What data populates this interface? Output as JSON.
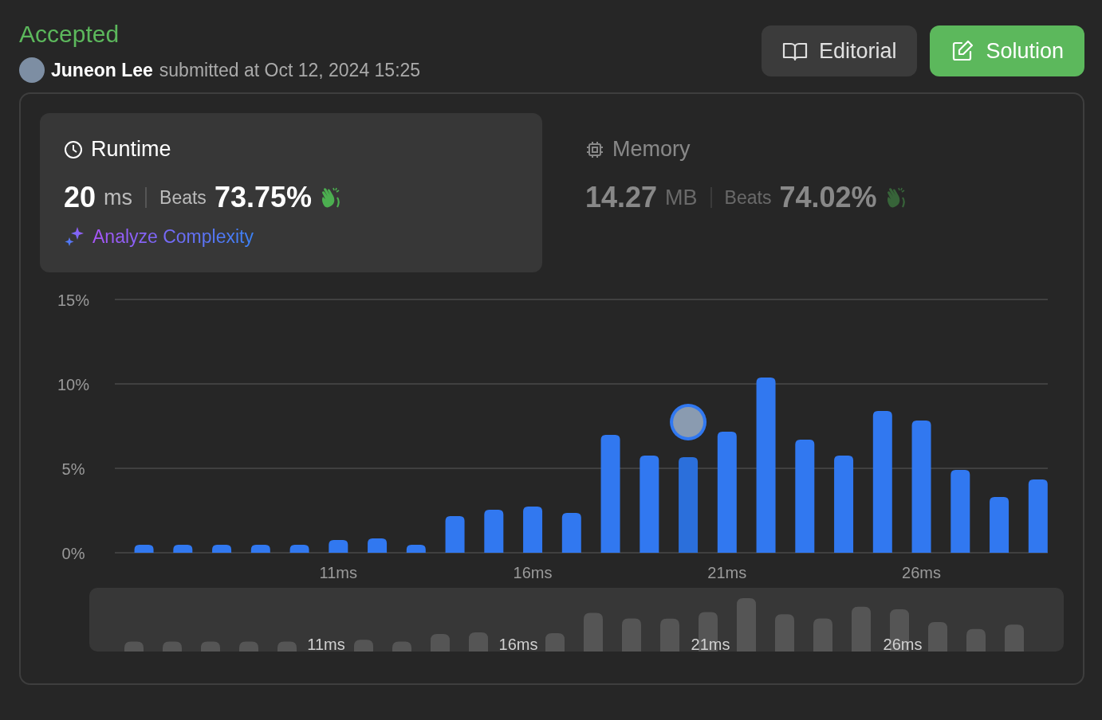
{
  "header": {
    "status": "Accepted",
    "user": "Juneon Lee",
    "submitted": "submitted at Oct 12, 2024 15:25"
  },
  "buttons": [
    {
      "label": "Editorial",
      "kind": "editorial"
    },
    {
      "label": "Solution",
      "kind": "solution"
    }
  ],
  "stats": [
    {
      "kind": "runtime",
      "title": "Runtime",
      "value": "20",
      "unit": "ms",
      "beats_label": "Beats",
      "percent": "73.75%",
      "selected": true,
      "link": "Analyze Complexity"
    },
    {
      "kind": "memory",
      "title": "Memory",
      "value": "14.27",
      "unit": "MB",
      "beats_label": "Beats",
      "percent": "74.02%",
      "selected": false
    }
  ],
  "chart": {
    "chart_data": {
      "type": "bar",
      "x": [
        6,
        7,
        8,
        9,
        10,
        11,
        12,
        13,
        14,
        15,
        16,
        17,
        18,
        19,
        20,
        21,
        22,
        23,
        24,
        25,
        26,
        27,
        28,
        29
      ],
      "values": [
        0.47,
        0.47,
        0.47,
        0.47,
        0.47,
        0.75,
        0.85,
        0.47,
        2.17,
        2.55,
        2.74,
        2.36,
        6.98,
        5.75,
        5.66,
        7.17,
        10.38,
        6.7,
        5.75,
        8.4,
        7.83,
        4.91,
        3.3,
        4.34
      ],
      "ylim": [
        0,
        15
      ],
      "yticks": [
        {
          "value": 0,
          "label": "0%"
        },
        {
          "value": 5,
          "label": "5%"
        },
        {
          "value": 10,
          "label": "10%"
        },
        {
          "value": 15,
          "label": "15%"
        }
      ],
      "xticks": [
        {
          "value": 11,
          "label": "11ms"
        },
        {
          "value": 16,
          "label": "16ms"
        },
        {
          "value": 21,
          "label": "21ms"
        },
        {
          "value": 26,
          "label": "26ms"
        }
      ],
      "xlim": [
        5.25,
        29.25
      ]
    },
    "bars": [
      {
        "selected": false
      },
      {
        "selected": false
      },
      {
        "selected": false
      },
      {
        "selected": false
      },
      {
        "selected": false
      },
      {
        "selected": false
      },
      {
        "selected": false
      },
      {
        "selected": false
      },
      {
        "selected": false
      },
      {
        "selected": false
      },
      {
        "selected": false
      },
      {
        "selected": false
      },
      {
        "selected": false
      },
      {
        "selected": false
      },
      {
        "selected": true
      },
      {
        "selected": false
      },
      {
        "selected": false
      },
      {
        "selected": false
      },
      {
        "selected": false
      },
      {
        "selected": false
      },
      {
        "selected": false
      },
      {
        "selected": false
      },
      {
        "selected": false
      },
      {
        "selected": false
      }
    ]
  },
  "navigator": {
    "tick_labels": [
      "11ms",
      "16ms",
      "21ms",
      "26ms"
    ]
  }
}
